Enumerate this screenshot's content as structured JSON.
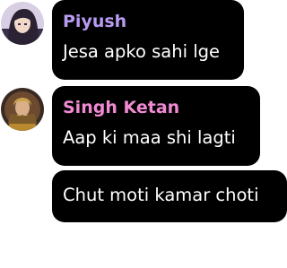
{
  "messages": [
    {
      "author": "Piyush",
      "author_color": "#b89cf2",
      "text": "Jesa apko sahi lge",
      "avatar_icon": "anime-girl-avatar"
    },
    {
      "author": "Singh Ketan",
      "author_color": "#f08ad2",
      "text": "Aap ki maa shi lagti",
      "avatar_icon": "anime-warrior-avatar"
    },
    {
      "author": "",
      "text": "Chut moti kamar choti"
    }
  ],
  "colors": {
    "bubble_background": "#000000",
    "message_text": "#ffffff",
    "page_background": "#ffffff"
  }
}
